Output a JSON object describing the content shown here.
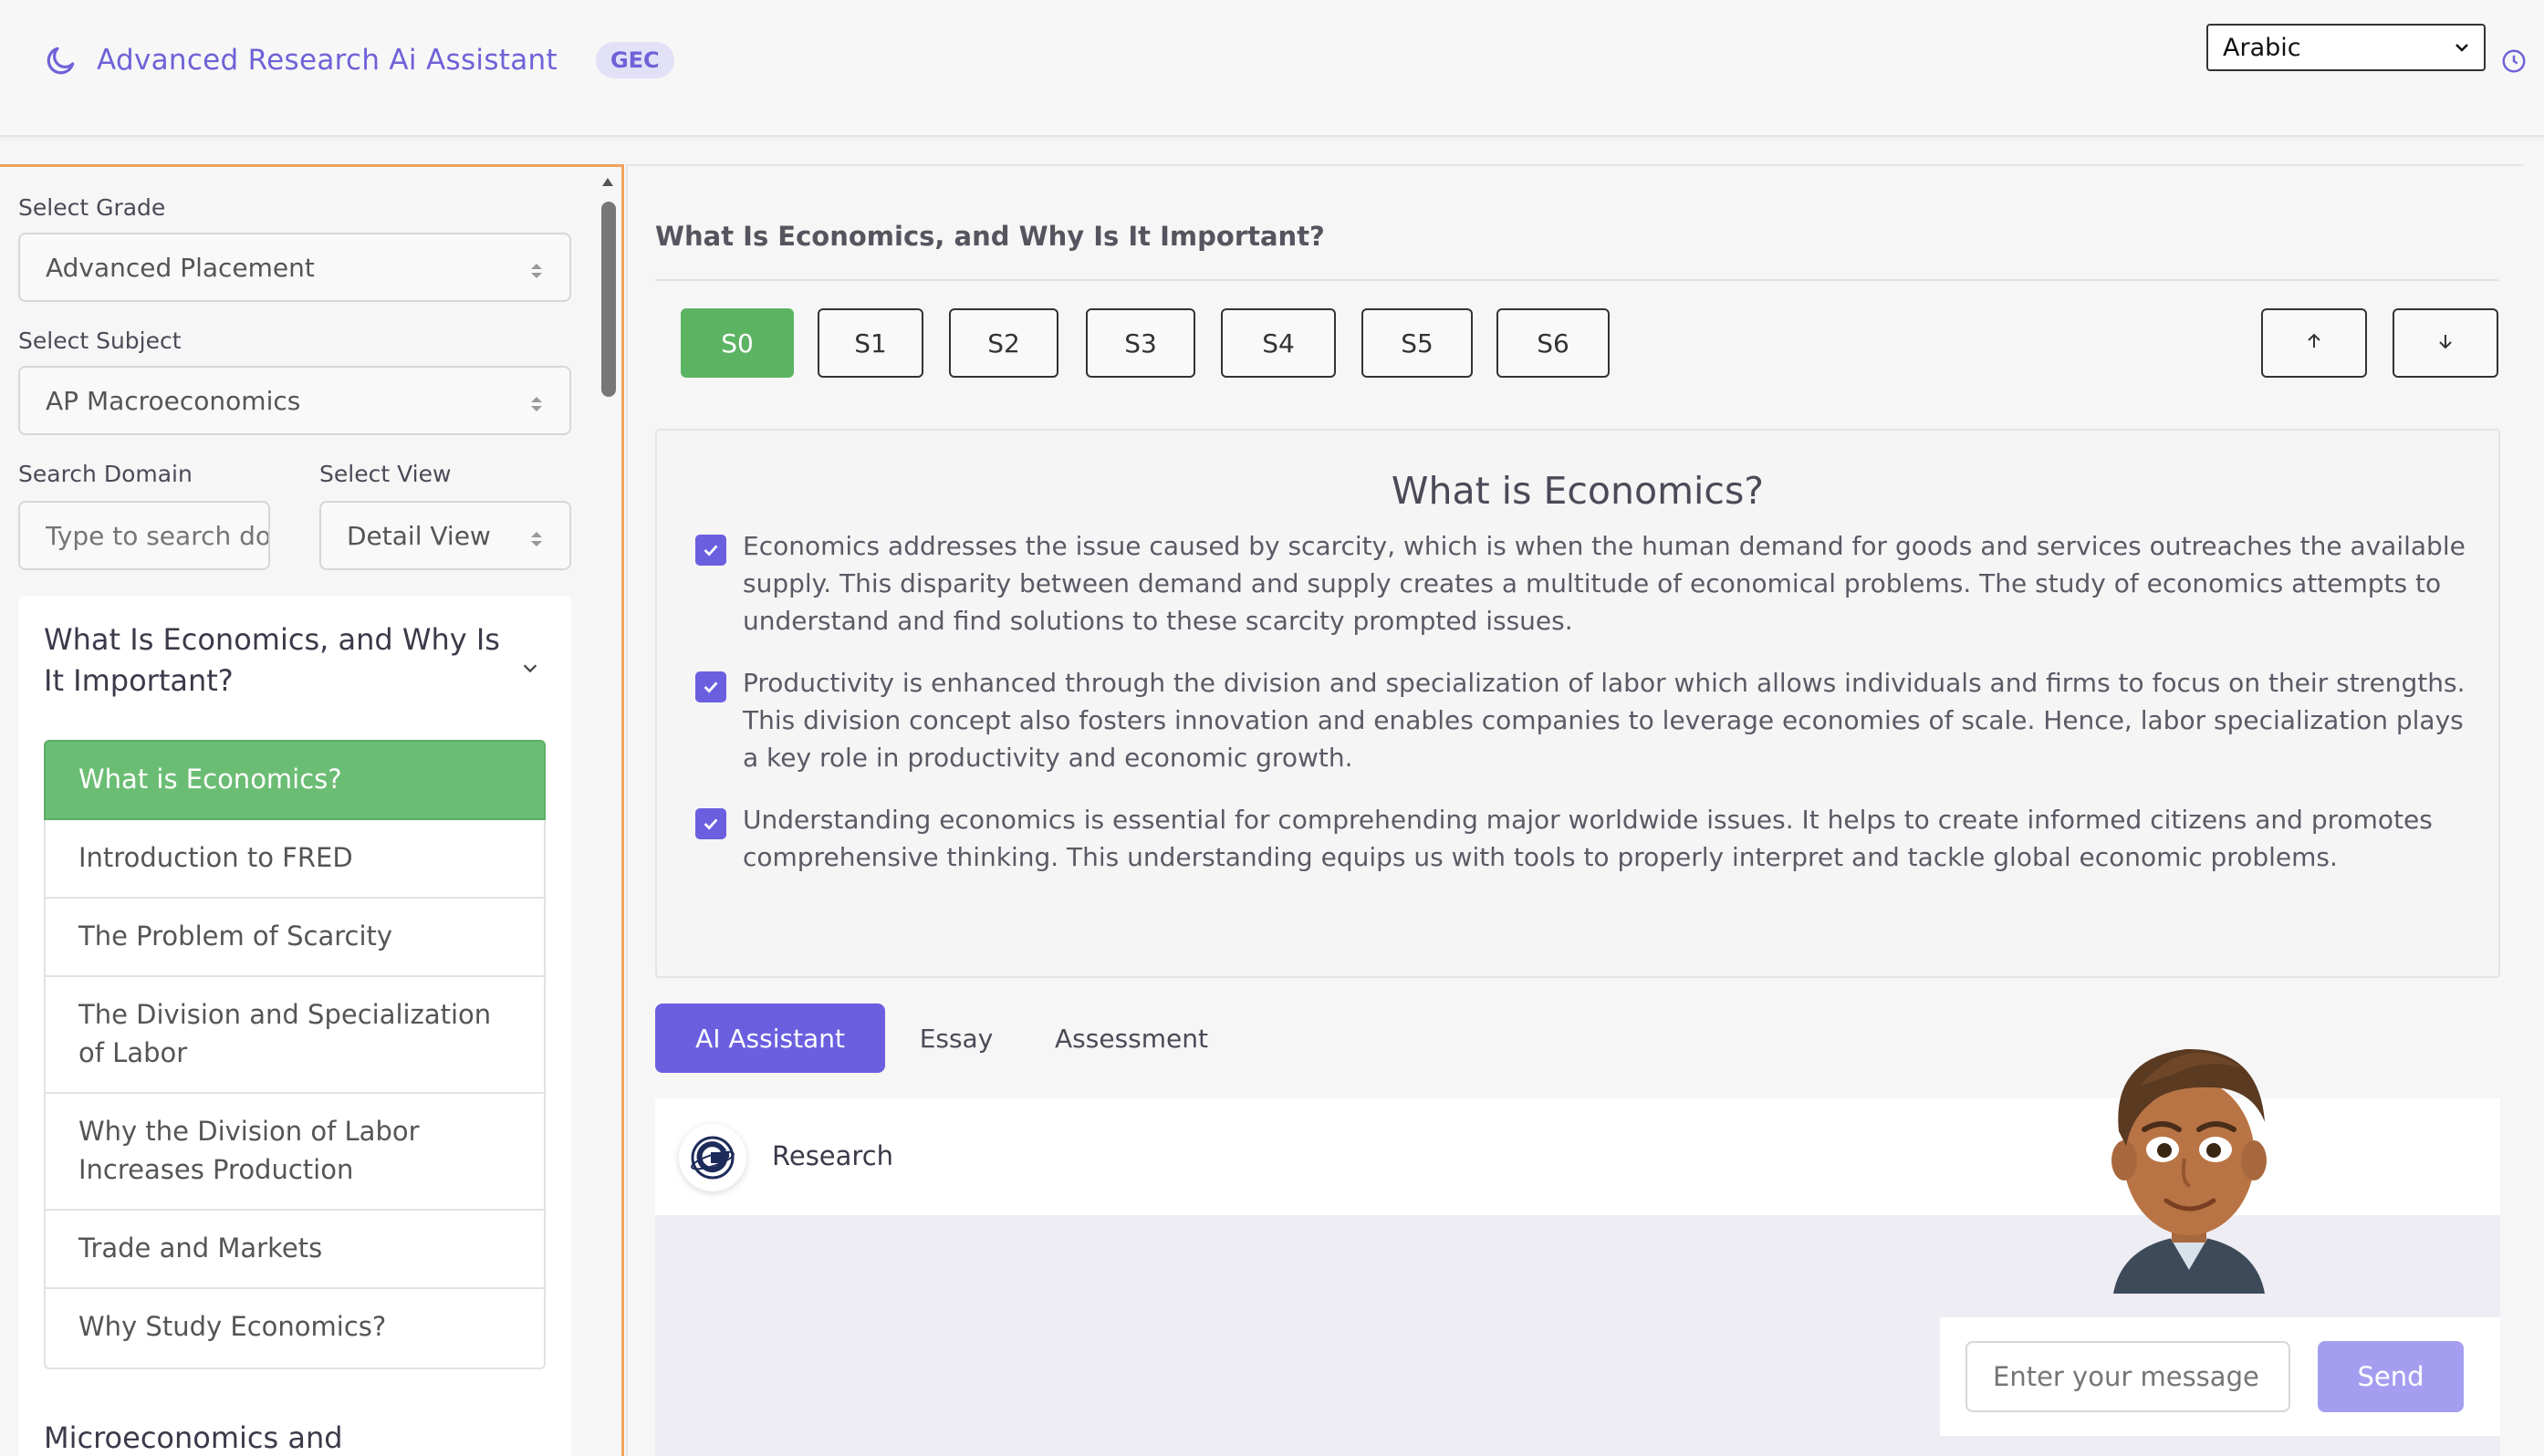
{
  "header": {
    "title": "Advanced Research Ai Assistant",
    "badge": "GEC",
    "language": "Arabic",
    "icons": {
      "brand": "moon-icon",
      "history": "clock-icon"
    }
  },
  "sidebar": {
    "grade_label": "Select Grade",
    "grade_value": "Advanced Placement",
    "subject_label": "Select Subject",
    "subject_value": "AP Macroeconomics",
    "search_label": "Search Domain",
    "search_placeholder": "Type to search domain",
    "view_label": "Select View",
    "view_value": "Detail View",
    "chapter_title": "What Is Economics, and Why Is It Important?",
    "lessons": [
      "What is Economics?",
      "Introduction to FRED",
      "The Problem of Scarcity",
      "The Division and Specialization of Labor",
      "Why the Division of Labor Increases Production",
      "Trade and Markets",
      "Why Study Economics?"
    ],
    "active_lesson": "What is Economics?",
    "next_chapter_title": "Microeconomics and"
  },
  "main": {
    "title": "What Is Economics, and Why Is It Important?",
    "sections": [
      "S0",
      "S1",
      "S2",
      "S3",
      "S4",
      "S5",
      "S6"
    ],
    "active_section": "S0",
    "content_heading": "What is Economics?",
    "points": [
      "Economics addresses the issue caused by scarcity, which is when the human demand for goods and services outreaches the available supply. This disparity between demand and supply creates a multitude of economical problems. The study of economics attempts to understand and find solutions to these scarcity prompted issues.",
      "Productivity is enhanced through the division and specialization of labor which allows individuals and firms to focus on their strengths. This division concept also fosters innovation and enables companies to leverage economies of scale. Hence, labor specialization plays a key role in productivity and economic growth.",
      "Understanding economics is essential for comprehending major worldwide issues. It helps to create informed citizens and promotes comprehensive thinking. This understanding equips us with tools to properly interpret and tackle global economic problems."
    ],
    "tabs": [
      "AI Assistant",
      "Essay",
      "Assessment"
    ],
    "active_tab": "AI Assistant",
    "assistant_label": "Research",
    "message_placeholder": "Enter your message",
    "send_label": "Send"
  },
  "colors": {
    "accent": "#6b5fe0",
    "active_green": "#5cb463",
    "sidebar_border": "#f2a25a"
  }
}
